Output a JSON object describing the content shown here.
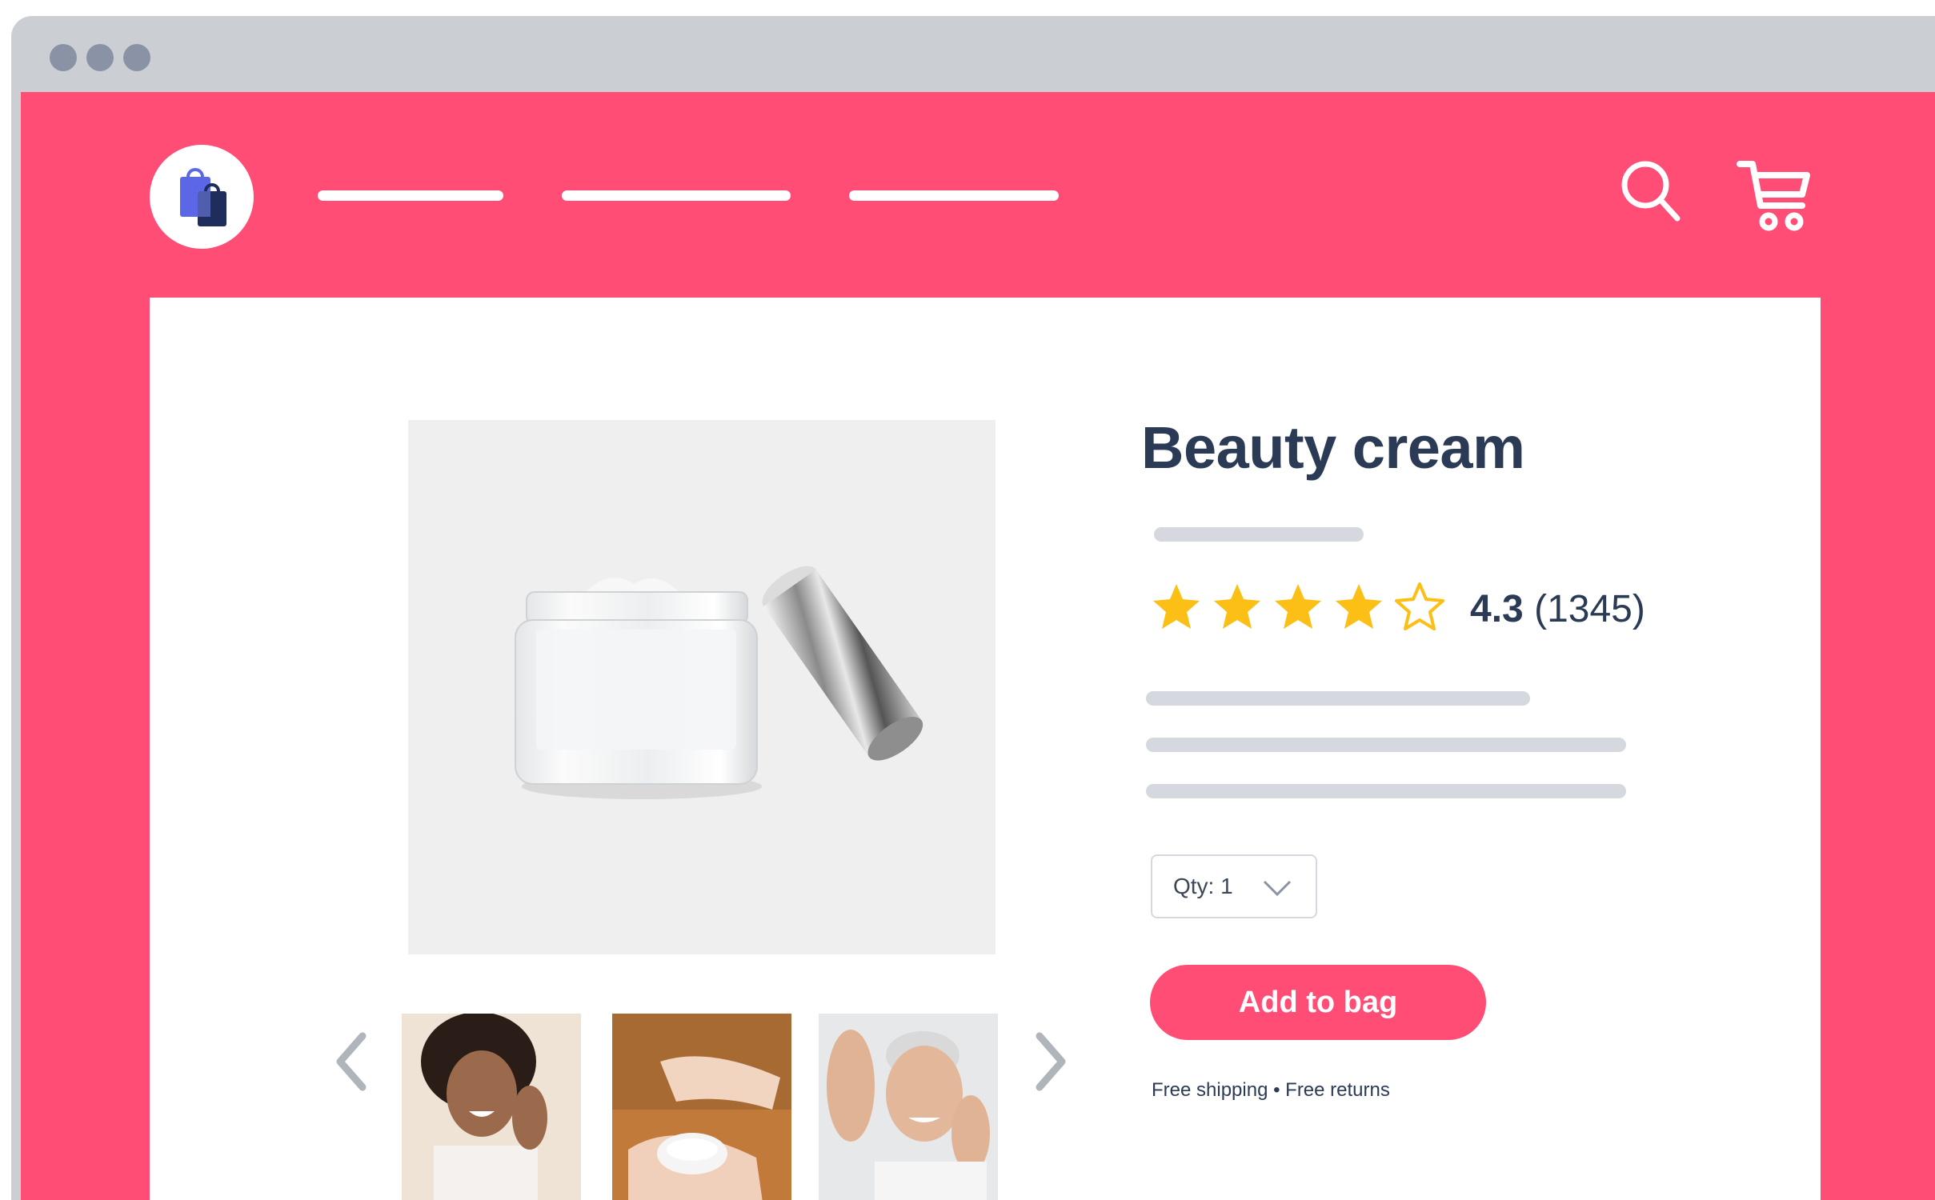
{
  "product": {
    "title": "Beauty cream",
    "rating": "4.3",
    "review_count": "(1345)",
    "stars_filled": 4,
    "stars_total": 5
  },
  "quantity": {
    "label": "Qty: 1",
    "selected": "1"
  },
  "actions": {
    "add_to_bag_label": "Add to bag"
  },
  "shipping_note": "Free shipping • Free returns",
  "icons": {
    "logo": "shopping-bags-icon",
    "search": "search-icon",
    "cart": "cart-icon",
    "prev": "chevron-left-icon",
    "next": "chevron-right-icon",
    "qty_dropdown": "chevron-down-icon"
  },
  "colors": {
    "brand": "#ff4d75",
    "heading": "#2b3a55",
    "star": "#fbbf16",
    "placeholder_bar": "#d5d8de"
  }
}
